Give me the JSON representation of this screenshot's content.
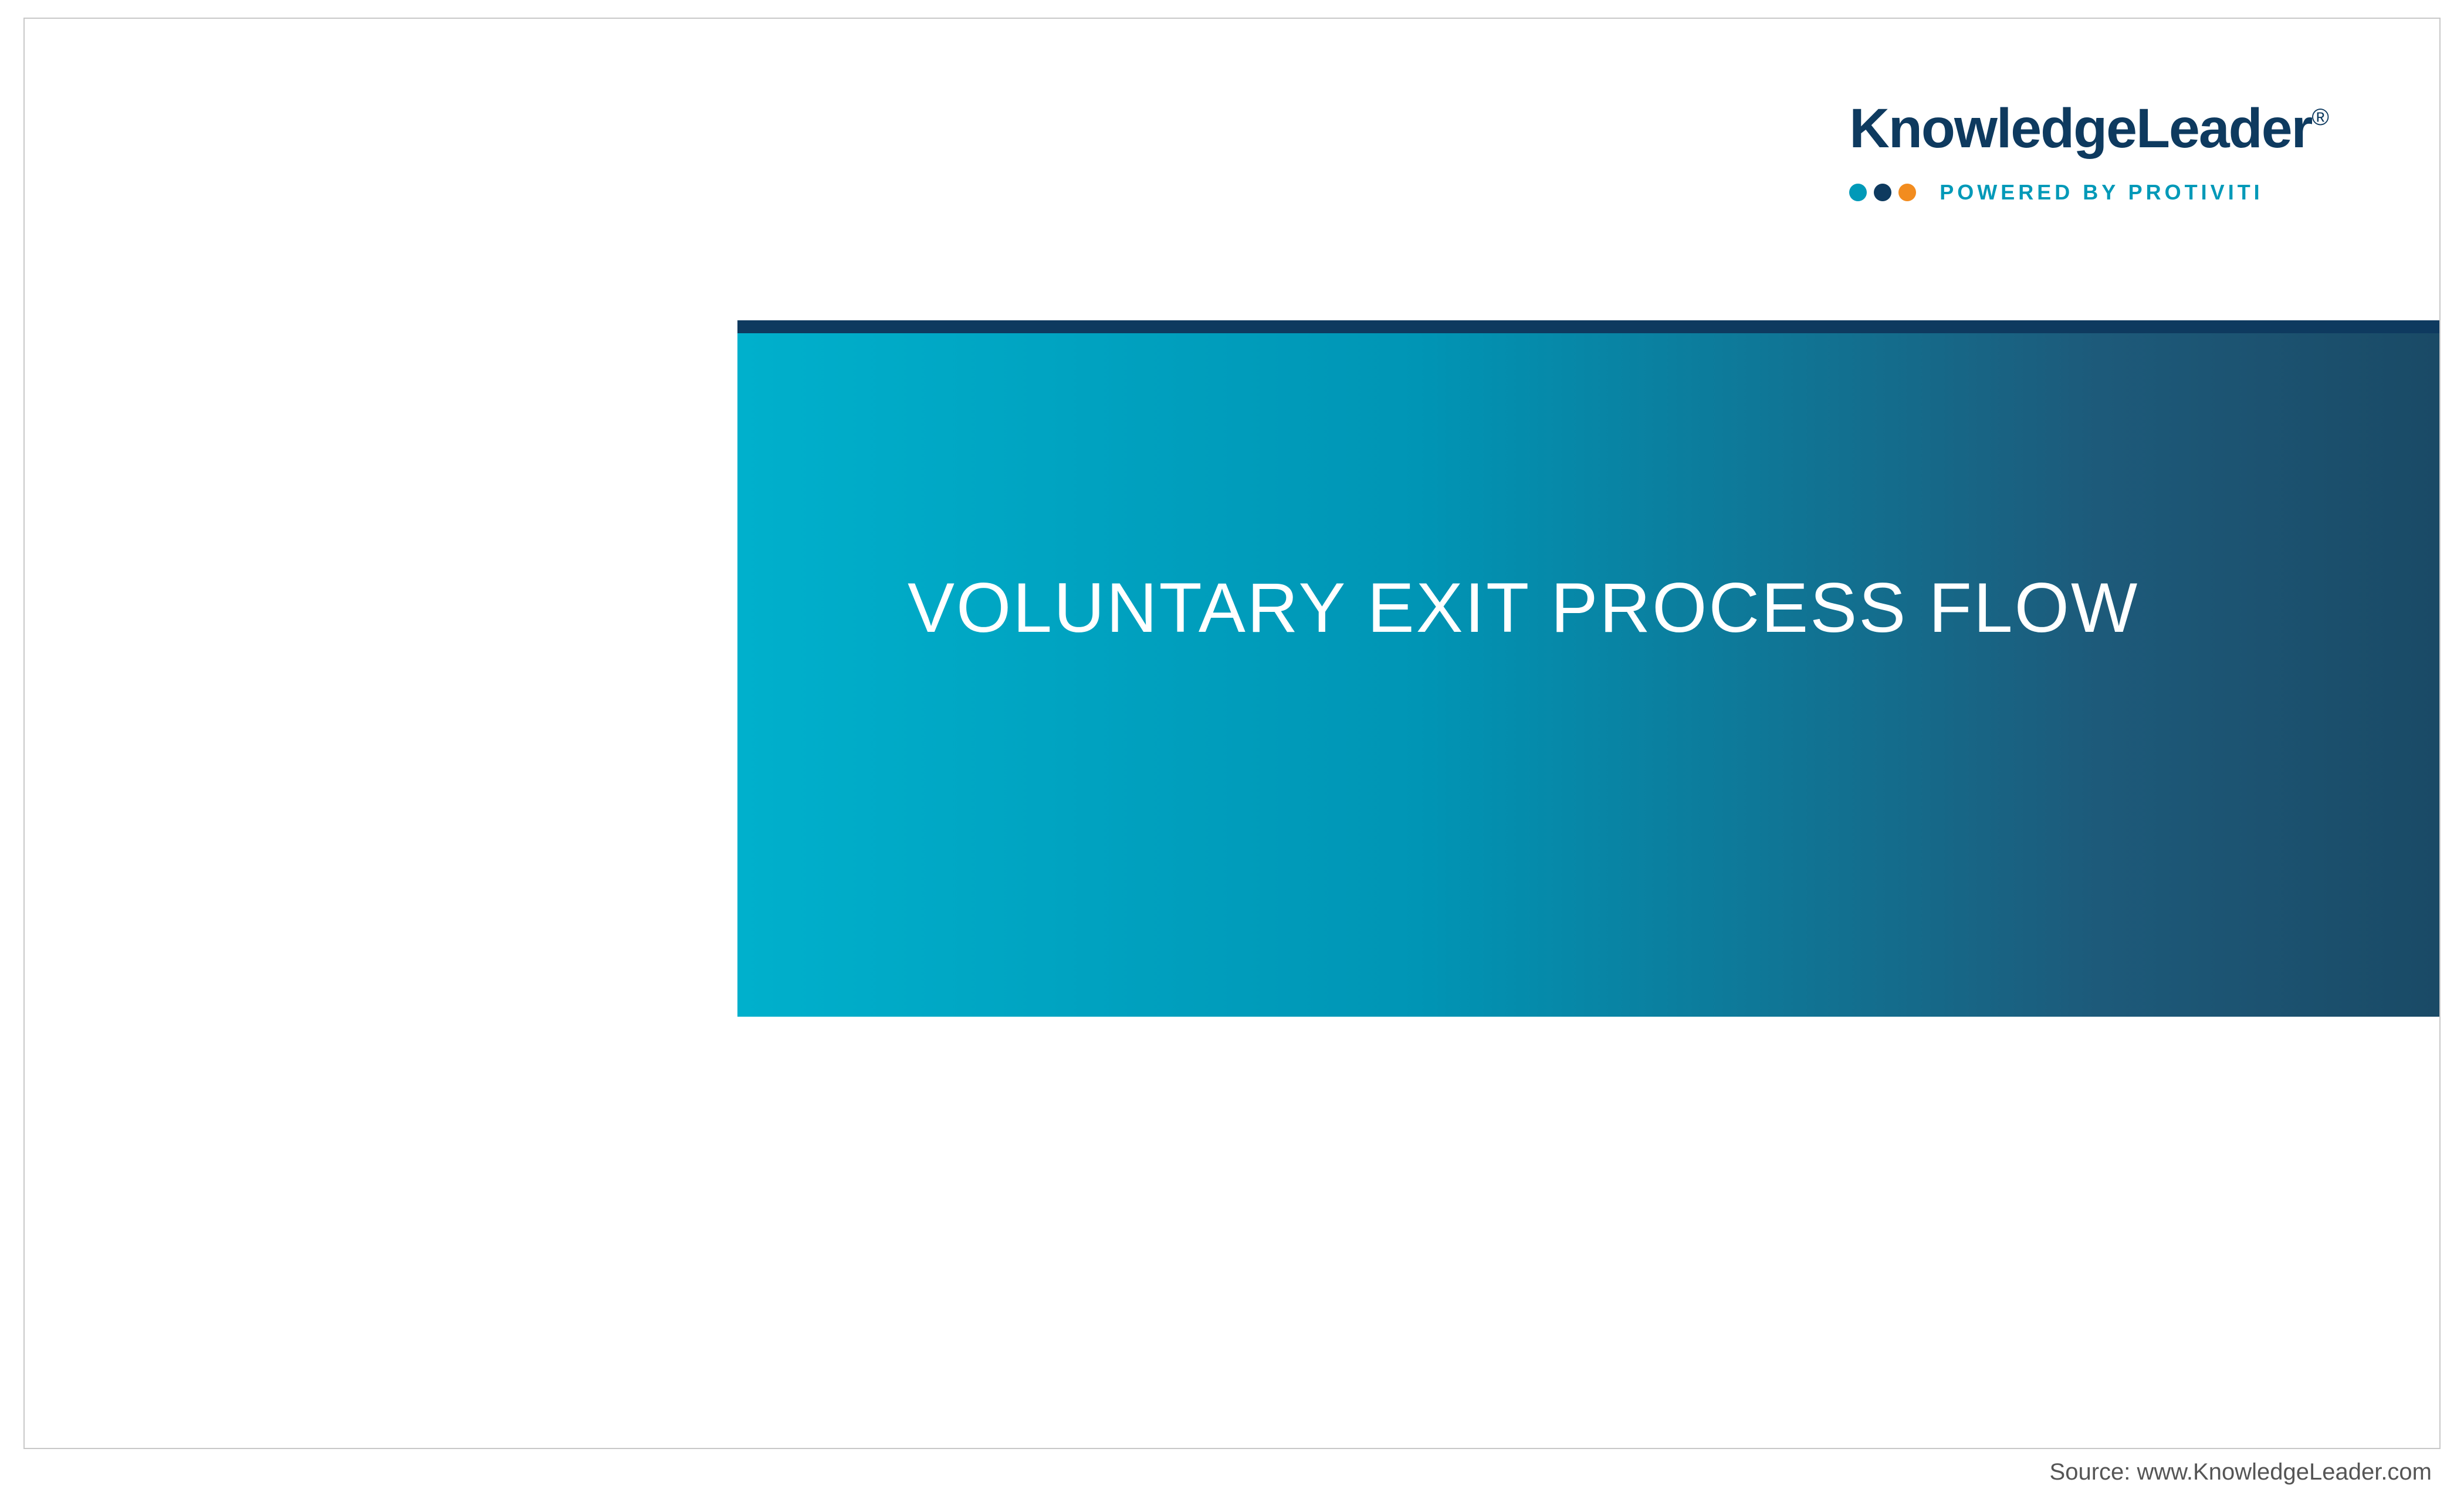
{
  "logo": {
    "main": "KnowledgeLeader",
    "registered": "®",
    "powered": "POWERED BY PROTIVITI"
  },
  "title": "VOLUNTARY EXIT PROCESS FLOW",
  "source": "Source: www.KnowledgeLeader.com",
  "colors": {
    "brand_dark": "#0e3a5f",
    "brand_teal": "#0099b8",
    "brand_orange": "#f28c1f",
    "panel_gradient_start": "#00b0cc",
    "panel_gradient_end": "#1a4a66"
  }
}
